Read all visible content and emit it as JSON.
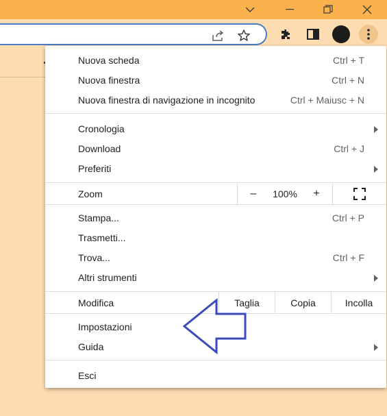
{
  "window": {
    "controls": [
      {
        "name": "minimize-icon"
      },
      {
        "name": "restore-icon"
      },
      {
        "name": "close-icon"
      }
    ],
    "titlebar_color": "#fbb24c",
    "toolbar_color": "#fedcb1"
  },
  "toolbar": {
    "icons": [
      "share-icon",
      "bookmark-star-icon",
      "extensions-icon",
      "side-panel-icon",
      "profile-avatar",
      "more-menu-icon"
    ]
  },
  "menu": {
    "sections": [
      {
        "items": [
          {
            "label": "Nuova scheda",
            "shortcut": "Ctrl + T"
          },
          {
            "label": "Nuova finestra",
            "shortcut": "Ctrl + N"
          },
          {
            "label": "Nuova finestra di navigazione in incognito",
            "shortcut": "Ctrl + Maiusc + N"
          }
        ]
      },
      {
        "items": [
          {
            "label": "Cronologia",
            "submenu": true
          },
          {
            "label": "Download",
            "shortcut": "Ctrl + J"
          },
          {
            "label": "Preferiti",
            "submenu": true
          }
        ]
      }
    ],
    "zoom": {
      "label": "Zoom",
      "minus": "–",
      "value": "100%",
      "plus": "+"
    },
    "tools": [
      {
        "label": "Stampa...",
        "shortcut": "Ctrl + P"
      },
      {
        "label": "Trasmetti..."
      },
      {
        "label": "Trova...",
        "shortcut": "Ctrl + F"
      },
      {
        "label": "Altri strumenti",
        "submenu": true
      }
    ],
    "edit": {
      "label": "Modifica",
      "cut": "Taglia",
      "copy": "Copia",
      "paste": "Incolla"
    },
    "settings": [
      {
        "label": "Impostazioni"
      },
      {
        "label": "Guida",
        "submenu": true
      }
    ],
    "exit": {
      "label": "Esci"
    }
  },
  "annotation": {
    "type": "arrow-pointing-left",
    "color": "#3a4bb8"
  }
}
